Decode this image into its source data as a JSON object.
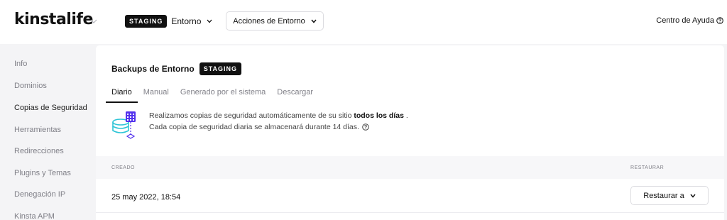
{
  "header": {
    "logo": "kinstalife",
    "env_badge": "STAGING",
    "env_label": "Entorno",
    "actions_label": "Acciones de Entorno",
    "help_label": "Centro de Ayuda"
  },
  "sidebar": {
    "items": [
      {
        "label": "Info",
        "active": false
      },
      {
        "label": "Dominios",
        "active": false
      },
      {
        "label": "Copias de Seguridad",
        "active": true
      },
      {
        "label": "Herramientas",
        "active": false
      },
      {
        "label": "Redirecciones",
        "active": false
      },
      {
        "label": "Plugins y Temas",
        "active": false
      },
      {
        "label": "Denegación IP",
        "active": false
      },
      {
        "label": "Kinsta APM",
        "active": false
      }
    ]
  },
  "main": {
    "title": "Backups de Entorno",
    "title_badge": "STAGING",
    "tabs": [
      {
        "label": "Diario",
        "active": true
      },
      {
        "label": "Manual",
        "active": false
      },
      {
        "label": "Generado por el sistema",
        "active": false
      },
      {
        "label": "Descargar",
        "active": false
      }
    ],
    "info": {
      "line1_prefix": "Realizamos copias de seguridad automáticamente de su sitio",
      "line1_bold": "todos los días",
      "line1_suffix": ".",
      "line2": "Cada copia de seguridad diaria se almacenará durante 14 días."
    },
    "table": {
      "col_created": "CREADO",
      "col_restore": "RESTAURAR",
      "rows": [
        {
          "created": "25 may 2022, 18:54",
          "restore_label": "Restaurar a"
        }
      ]
    }
  },
  "colors": {
    "accent_purple": "#5333ed",
    "accent_teal": "#2ec4d6",
    "badge_bg": "#111111"
  }
}
